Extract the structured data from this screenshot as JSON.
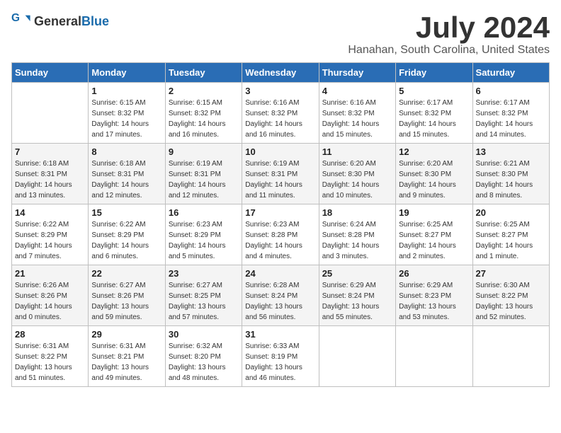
{
  "header": {
    "logo_general": "General",
    "logo_blue": "Blue",
    "month": "July 2024",
    "location": "Hanahan, South Carolina, United States"
  },
  "days_of_week": [
    "Sunday",
    "Monday",
    "Tuesday",
    "Wednesday",
    "Thursday",
    "Friday",
    "Saturday"
  ],
  "weeks": [
    [
      {
        "day": "",
        "info": ""
      },
      {
        "day": "1",
        "info": "Sunrise: 6:15 AM\nSunset: 8:32 PM\nDaylight: 14 hours\nand 17 minutes."
      },
      {
        "day": "2",
        "info": "Sunrise: 6:15 AM\nSunset: 8:32 PM\nDaylight: 14 hours\nand 16 minutes."
      },
      {
        "day": "3",
        "info": "Sunrise: 6:16 AM\nSunset: 8:32 PM\nDaylight: 14 hours\nand 16 minutes."
      },
      {
        "day": "4",
        "info": "Sunrise: 6:16 AM\nSunset: 8:32 PM\nDaylight: 14 hours\nand 15 minutes."
      },
      {
        "day": "5",
        "info": "Sunrise: 6:17 AM\nSunset: 8:32 PM\nDaylight: 14 hours\nand 15 minutes."
      },
      {
        "day": "6",
        "info": "Sunrise: 6:17 AM\nSunset: 8:32 PM\nDaylight: 14 hours\nand 14 minutes."
      }
    ],
    [
      {
        "day": "7",
        "info": "Sunrise: 6:18 AM\nSunset: 8:31 PM\nDaylight: 14 hours\nand 13 minutes."
      },
      {
        "day": "8",
        "info": "Sunrise: 6:18 AM\nSunset: 8:31 PM\nDaylight: 14 hours\nand 12 minutes."
      },
      {
        "day": "9",
        "info": "Sunrise: 6:19 AM\nSunset: 8:31 PM\nDaylight: 14 hours\nand 12 minutes."
      },
      {
        "day": "10",
        "info": "Sunrise: 6:19 AM\nSunset: 8:31 PM\nDaylight: 14 hours\nand 11 minutes."
      },
      {
        "day": "11",
        "info": "Sunrise: 6:20 AM\nSunset: 8:30 PM\nDaylight: 14 hours\nand 10 minutes."
      },
      {
        "day": "12",
        "info": "Sunrise: 6:20 AM\nSunset: 8:30 PM\nDaylight: 14 hours\nand 9 minutes."
      },
      {
        "day": "13",
        "info": "Sunrise: 6:21 AM\nSunset: 8:30 PM\nDaylight: 14 hours\nand 8 minutes."
      }
    ],
    [
      {
        "day": "14",
        "info": "Sunrise: 6:22 AM\nSunset: 8:29 PM\nDaylight: 14 hours\nand 7 minutes."
      },
      {
        "day": "15",
        "info": "Sunrise: 6:22 AM\nSunset: 8:29 PM\nDaylight: 14 hours\nand 6 minutes."
      },
      {
        "day": "16",
        "info": "Sunrise: 6:23 AM\nSunset: 8:29 PM\nDaylight: 14 hours\nand 5 minutes."
      },
      {
        "day": "17",
        "info": "Sunrise: 6:23 AM\nSunset: 8:28 PM\nDaylight: 14 hours\nand 4 minutes."
      },
      {
        "day": "18",
        "info": "Sunrise: 6:24 AM\nSunset: 8:28 PM\nDaylight: 14 hours\nand 3 minutes."
      },
      {
        "day": "19",
        "info": "Sunrise: 6:25 AM\nSunset: 8:27 PM\nDaylight: 14 hours\nand 2 minutes."
      },
      {
        "day": "20",
        "info": "Sunrise: 6:25 AM\nSunset: 8:27 PM\nDaylight: 14 hours\nand 1 minute."
      }
    ],
    [
      {
        "day": "21",
        "info": "Sunrise: 6:26 AM\nSunset: 8:26 PM\nDaylight: 14 hours\nand 0 minutes."
      },
      {
        "day": "22",
        "info": "Sunrise: 6:27 AM\nSunset: 8:26 PM\nDaylight: 13 hours\nand 59 minutes."
      },
      {
        "day": "23",
        "info": "Sunrise: 6:27 AM\nSunset: 8:25 PM\nDaylight: 13 hours\nand 57 minutes."
      },
      {
        "day": "24",
        "info": "Sunrise: 6:28 AM\nSunset: 8:24 PM\nDaylight: 13 hours\nand 56 minutes."
      },
      {
        "day": "25",
        "info": "Sunrise: 6:29 AM\nSunset: 8:24 PM\nDaylight: 13 hours\nand 55 minutes."
      },
      {
        "day": "26",
        "info": "Sunrise: 6:29 AM\nSunset: 8:23 PM\nDaylight: 13 hours\nand 53 minutes."
      },
      {
        "day": "27",
        "info": "Sunrise: 6:30 AM\nSunset: 8:22 PM\nDaylight: 13 hours\nand 52 minutes."
      }
    ],
    [
      {
        "day": "28",
        "info": "Sunrise: 6:31 AM\nSunset: 8:22 PM\nDaylight: 13 hours\nand 51 minutes."
      },
      {
        "day": "29",
        "info": "Sunrise: 6:31 AM\nSunset: 8:21 PM\nDaylight: 13 hours\nand 49 minutes."
      },
      {
        "day": "30",
        "info": "Sunrise: 6:32 AM\nSunset: 8:20 PM\nDaylight: 13 hours\nand 48 minutes."
      },
      {
        "day": "31",
        "info": "Sunrise: 6:33 AM\nSunset: 8:19 PM\nDaylight: 13 hours\nand 46 minutes."
      },
      {
        "day": "",
        "info": ""
      },
      {
        "day": "",
        "info": ""
      },
      {
        "day": "",
        "info": ""
      }
    ]
  ]
}
